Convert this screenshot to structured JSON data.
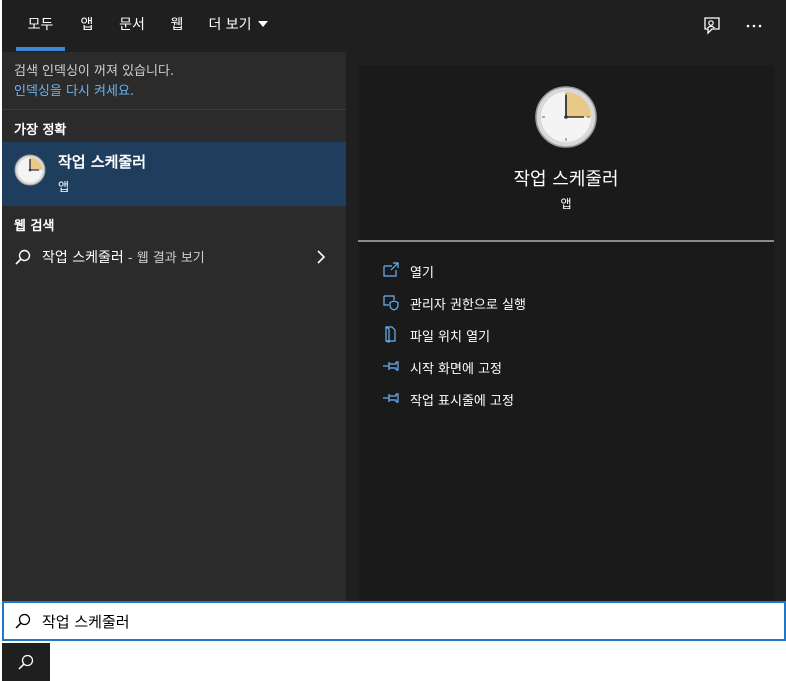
{
  "tabs": [
    {
      "label": "모두",
      "active": true
    },
    {
      "label": "앱"
    },
    {
      "label": "문서"
    },
    {
      "label": "웹"
    },
    {
      "label": "더 보기"
    }
  ],
  "top_icons": [
    "feedback-icon",
    "more-options-icon"
  ],
  "notice": {
    "text": "검색 인덱싱이 꺼져 있습니다.",
    "link": "인덱싱을 다시 켜세요."
  },
  "best_match": {
    "section_title": "가장 정확",
    "title": "작업 스케줄러",
    "subtitle": "앱",
    "icon": "clock-icon"
  },
  "web_search": {
    "section_title": "웹 검색",
    "query": "작업 스케줄러",
    "suffix": " - 웹 결과 보기"
  },
  "preview": {
    "title": "작업 스케줄러",
    "subtitle": "앱",
    "actions": [
      {
        "label": "열기",
        "icon": "open-icon"
      },
      {
        "label": "관리자 권한으로 실행",
        "icon": "admin-shield-icon"
      },
      {
        "label": "파일 위치 열기",
        "icon": "file-location-icon"
      },
      {
        "label": "시작 화면에 고정",
        "icon": "pin-icon"
      },
      {
        "label": "작업 표시줄에 고정",
        "icon": "pin-icon"
      }
    ]
  },
  "search": {
    "value": "작업 스케줄러"
  },
  "colors": {
    "accent": "#3d86d6",
    "link": "#6ab4f5",
    "selected": "#1f3d5c"
  }
}
